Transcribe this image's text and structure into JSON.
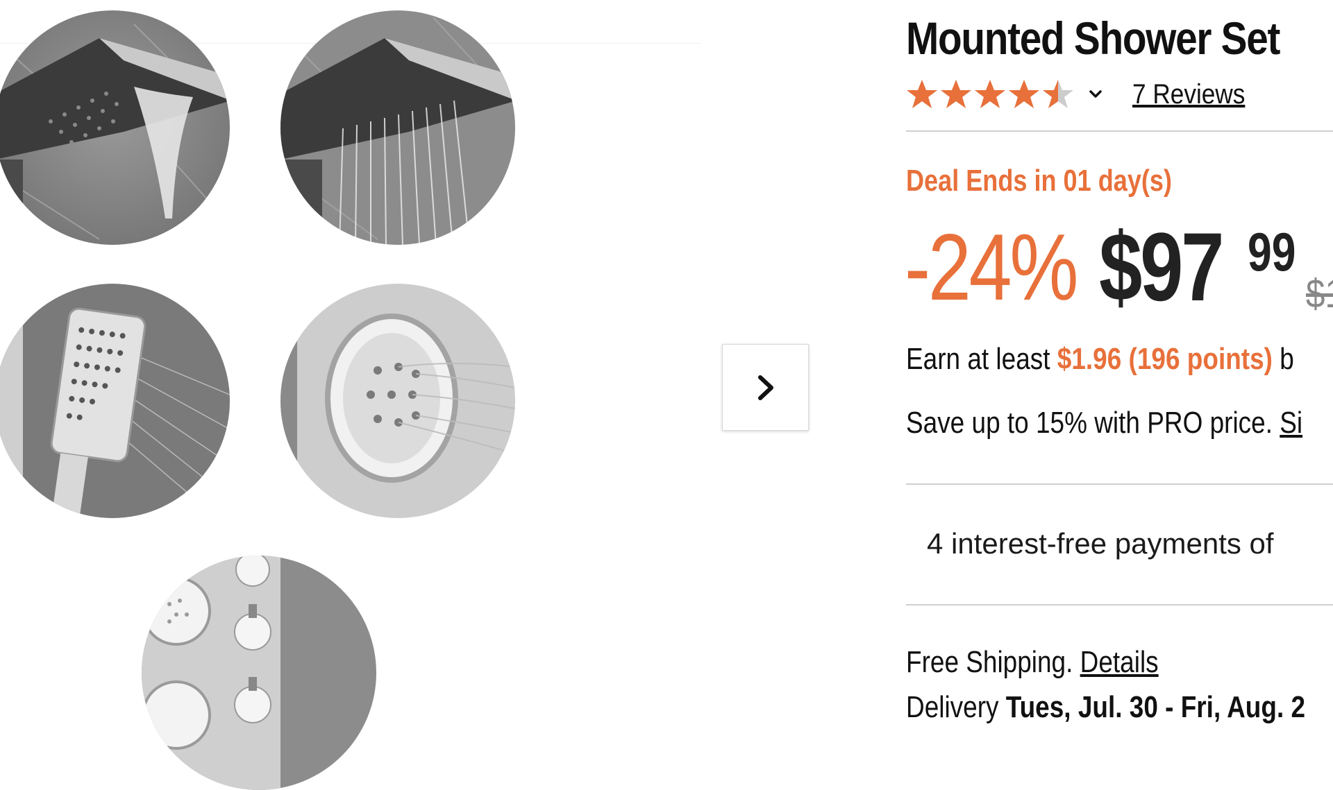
{
  "product": {
    "title": "Mounted Shower Set",
    "rating": 4.5,
    "rating_max": 5,
    "reviews_link": "7 Reviews",
    "deal_text": "Deal Ends in 01 day(s)",
    "discount": "-24%",
    "price_dollars": "$97",
    "price_cents": "99",
    "was_price": "$1",
    "earn": {
      "prefix": "Earn at least ",
      "points": "$1.96 (196 points)",
      "suffix": " b"
    },
    "pro": {
      "text": "Save up to 15% with PRO price. ",
      "link": "Si"
    },
    "installments": "4 interest-free payments of",
    "shipping": {
      "text": "Free Shipping. ",
      "link": "Details"
    },
    "delivery": {
      "prefix": "Delivery ",
      "dates": "Tues, Jul. 30 - Fri, Aug. 2"
    }
  },
  "gallery": {
    "next_icon": "chevron-right-icon",
    "images": [
      "waterfall-shower-head",
      "rainfall-shower-head",
      "handheld-shower",
      "body-jet",
      "control-knobs"
    ]
  },
  "colors": {
    "accent": "#e8703a",
    "text": "#111111",
    "star_empty": "#cccccc",
    "divider": "#cfcfcf"
  }
}
